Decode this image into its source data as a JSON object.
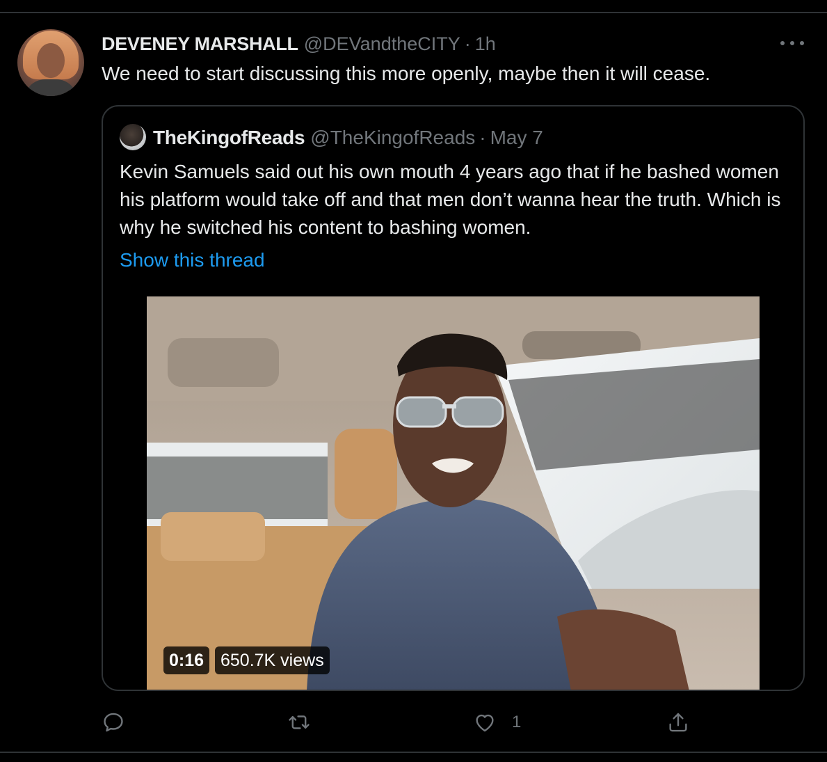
{
  "tweet": {
    "author_name": "DEVENEY MARSHALL",
    "author_handle": "@DEVandtheCITY",
    "separator": "·",
    "time": "1h",
    "text": "We need to start discussing this more openly, maybe then it will cease."
  },
  "quoted_tweet": {
    "author_name": "TheKingofReads",
    "author_handle": "@TheKingofReads",
    "separator": "·",
    "time": "May 7",
    "text": "Kevin Samuels said out his own mouth 4 years ago that if he bashed women his platform would take off and that men don’t wanna hear the truth. Which is why he switched his content to bashing women.",
    "show_thread_label": "Show this thread",
    "video": {
      "duration": "0:16",
      "views": "650.7K views"
    }
  },
  "actions": {
    "reply_icon": "reply-icon",
    "retweet_icon": "retweet-icon",
    "like_icon": "like-icon",
    "like_count": "1",
    "share_icon": "share-icon"
  },
  "colors": {
    "background": "#000000",
    "text_primary": "#e7e9ea",
    "text_secondary": "#71767b",
    "link": "#1d9bf0",
    "border": "#2f3336"
  }
}
